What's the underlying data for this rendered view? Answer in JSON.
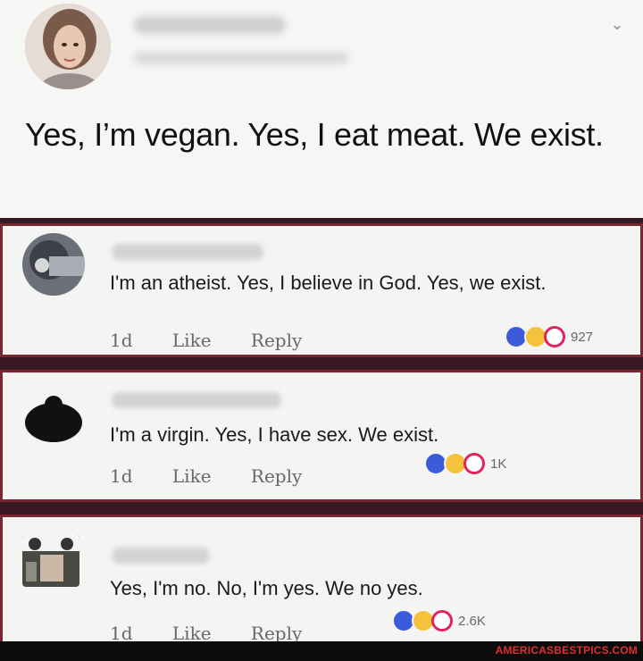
{
  "post": {
    "text": "Yes, I’m vegan. Yes, I eat meat. We exist."
  },
  "actions": {
    "time": "1d",
    "like": "Like",
    "reply": "Reply"
  },
  "comments": [
    {
      "text": "I'm an atheist. Yes, I believe in God. Yes, we exist.",
      "reaction_count": "927"
    },
    {
      "text": "I'm a virgin. Yes, I have sex. We exist.",
      "reaction_count": "1K"
    },
    {
      "text": "Yes, I'm no. No, I'm yes. We no yes.",
      "reaction_count": "2.6K"
    }
  ],
  "watermark": "AMERICASBESTPICS.COM",
  "icons": [
    "chevron-down-icon",
    "like-reaction-icon",
    "haha-reaction-icon",
    "love-reaction-icon"
  ],
  "colors": {
    "like": "#3b5bdb",
    "haha": "#f5c33b",
    "love": "#e0245e",
    "frame": "#7a2632",
    "watermark": "#e03030"
  }
}
